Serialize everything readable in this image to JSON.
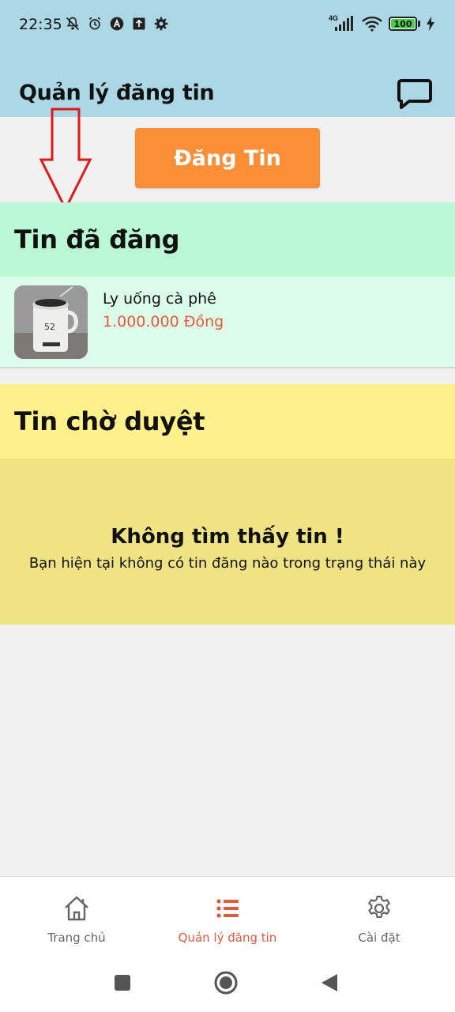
{
  "status_bar": {
    "time": "22:35",
    "network": "4G",
    "battery": "100",
    "battery_color": "#47d14a"
  },
  "header": {
    "title": "Quản lý đăng tin",
    "chat_icon": "chat-bubble-icon",
    "background": "#acd8e6"
  },
  "post_button": {
    "label": "Đăng Tin",
    "color": "#fb8f38"
  },
  "posted_section": {
    "title": "Tin đã đăng",
    "items": [
      {
        "name": "Ly uống cà phê",
        "price": "1.000.000 Đồng"
      }
    ]
  },
  "pending_section": {
    "title": "Tin chờ duyệt",
    "empty_title": "Không tìm thấy tin !",
    "empty_desc": "Bạn hiện tại không có tin đăng nào trong trạng thái này"
  },
  "bottom_nav": {
    "items": [
      {
        "label": "Trang chủ",
        "icon": "home-icon",
        "active": false
      },
      {
        "label": "Quản lý đăng tin",
        "icon": "list-icon",
        "active": true
      },
      {
        "label": "Cài đặt",
        "icon": "gear-icon",
        "active": false
      }
    ],
    "active_color": "#e3593d"
  }
}
